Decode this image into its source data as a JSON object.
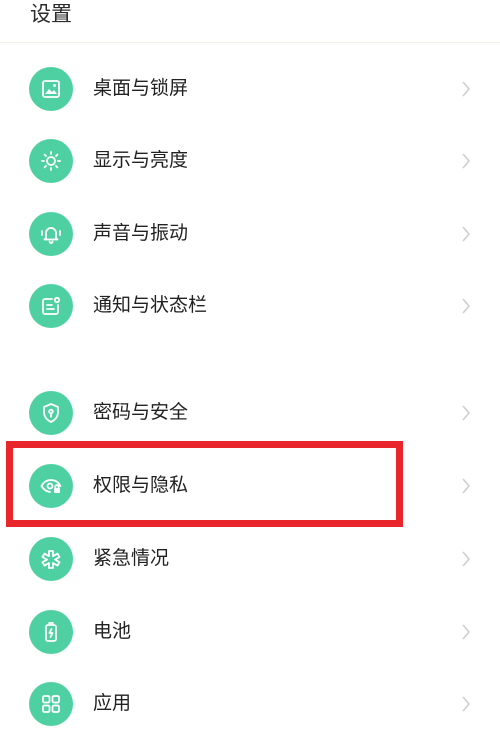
{
  "header": {
    "title": "设置"
  },
  "items": [
    {
      "label": "桌面与锁屏",
      "icon": "wallpaper-icon"
    },
    {
      "label": "显示与亮度",
      "icon": "brightness-icon"
    },
    {
      "label": "声音与振动",
      "icon": "bell-vibrate-icon"
    },
    {
      "label": "通知与状态栏",
      "icon": "notification-icon"
    },
    {
      "label": "密码与安全",
      "icon": "shield-icon"
    },
    {
      "label": "权限与隐私",
      "icon": "privacy-eye-icon"
    },
    {
      "label": "紧急情况",
      "icon": "emergency-icon"
    },
    {
      "label": "电池",
      "icon": "battery-icon"
    },
    {
      "label": "应用",
      "icon": "apps-grid-icon"
    }
  ],
  "colors": {
    "accent": "#4fd0a3",
    "highlight": "#e8262b",
    "chevron": "#cfcfcf"
  }
}
